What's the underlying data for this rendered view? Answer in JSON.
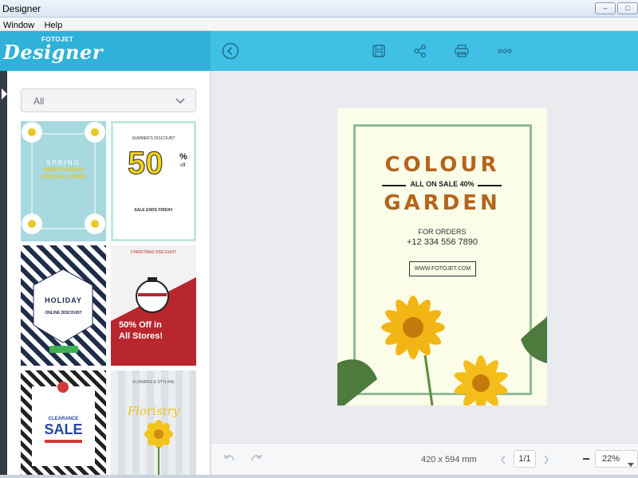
{
  "window": {
    "title": "Designer",
    "controls": [
      "minimize",
      "maximize"
    ]
  },
  "menu": {
    "items": [
      "Window",
      "Help"
    ]
  },
  "brand": {
    "small": "FOTOJET",
    "big": "Designer"
  },
  "toolbar": {
    "back_icon": "back-circle-icon",
    "save_icon": "save-icon",
    "share_icon": "share-icon",
    "print_icon": "print-icon",
    "more_icon": "more-icon"
  },
  "sidebar": {
    "filter": {
      "value": "All"
    },
    "templates": [
      {
        "name": "spring-fashion",
        "lines": [
          "SPRING",
          "NEW FASHION",
          "SPECIAL OFFER"
        ]
      },
      {
        "name": "summer-discount",
        "lines": [
          "SUMMER'S DISCOUNT",
          "50",
          "%",
          "off",
          "SALE ENDS FRIDAY"
        ]
      },
      {
        "name": "holiday",
        "lines": [
          "HOLIDAY",
          "ONLINE DISCOUNT"
        ]
      },
      {
        "name": "christmas",
        "lines": [
          "CHRISTMAS  DISCOUNT",
          "50% Off in",
          "All Stores!"
        ]
      },
      {
        "name": "clearance",
        "lines": [
          "CLEARANCE",
          "SALE"
        ]
      },
      {
        "name": "floristry",
        "lines": [
          "FLOWERS & STYLING",
          "Floristry"
        ]
      }
    ]
  },
  "poster": {
    "title_top": "COLOUR",
    "tagline": "ALL ON SALE 40%",
    "title_bottom": "GARDEN",
    "orders_label": "FOR ORDERS",
    "phone": "+12 334 556 7890",
    "website": "WWW.FOTOJET.COM"
  },
  "bottom": {
    "size": "420 x 594 mm",
    "page": "1/1",
    "zoom": "22%"
  },
  "colors": {
    "accent": "#41c0e6",
    "brand_dark": "#2fb1da",
    "poster_title": "#b5651d"
  }
}
